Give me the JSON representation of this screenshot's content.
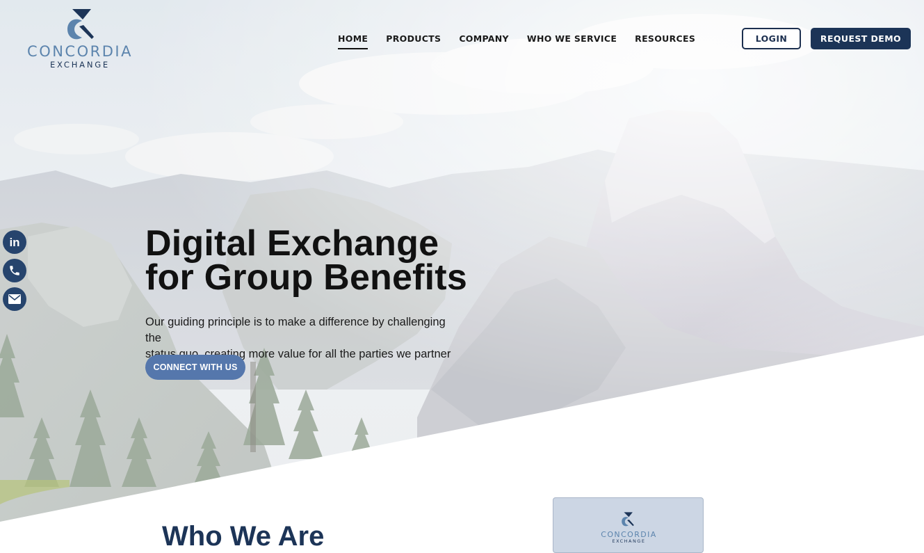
{
  "logo": {
    "word": "CONCORDIA",
    "sub": "EXCHANGE"
  },
  "nav": {
    "items": [
      {
        "label": "HOME"
      },
      {
        "label": "PRODUCTS"
      },
      {
        "label": "COMPANY"
      },
      {
        "label": "WHO WE SERVICE"
      },
      {
        "label": "RESOURCES"
      }
    ],
    "active": "HOME"
  },
  "header": {
    "login_label": "LOGIN",
    "demo_label": "REQUEST DEMO"
  },
  "social": {
    "icons": [
      "linkedin-icon",
      "phone-icon",
      "mail-icon"
    ],
    "linkedin_glyph": "in"
  },
  "hero": {
    "headline_line1": "Digital Exchange",
    "headline_line2": "for Group Benefits",
    "subtext_line1": "Our guiding principle is to make a difference by challenging the",
    "subtext_line2": "status quo, creating more value for all the parties we partner with.",
    "cta_label": "CONNECT WITH US"
  },
  "who": {
    "title": "Who We Are"
  },
  "card": {
    "word": "CONCORDIA",
    "sub": "EXCHANGE"
  },
  "colors": {
    "navy": "#1c3457",
    "brand_blue": "#5c84ad",
    "cta_blue": "#5577ac",
    "social_bg": "#26446d",
    "card_bg": "#ccd6e4"
  }
}
